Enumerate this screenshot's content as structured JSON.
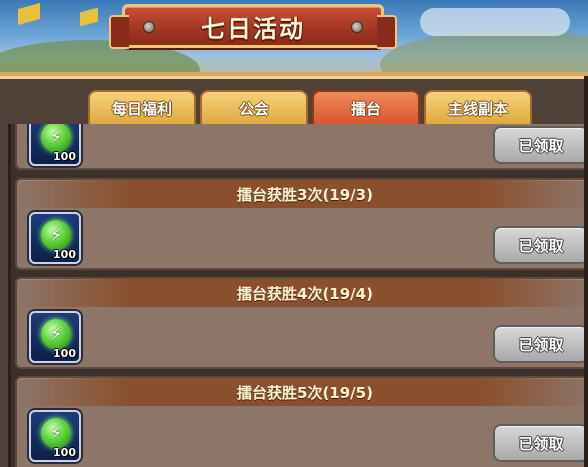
{
  "title": "七日活动",
  "tabs": [
    {
      "label": "每日福利",
      "active": false
    },
    {
      "label": "公会",
      "active": false
    },
    {
      "label": "擂台",
      "active": true
    },
    {
      "label": "主线副本",
      "active": false
    }
  ],
  "partial_card": {
    "reward": {
      "icon": "energy-bolt-icon",
      "quantity": "100"
    },
    "button_label": "已领取"
  },
  "cards": [
    {
      "header": "擂台获胜3次(19/3)",
      "reward": {
        "icon": "energy-bolt-icon",
        "quantity": "100"
      },
      "button_label": "已领取"
    },
    {
      "header": "擂台获胜4次(19/4)",
      "reward": {
        "icon": "energy-bolt-icon",
        "quantity": "100"
      },
      "button_label": "已领取"
    },
    {
      "header": "擂台获胜5次(19/5)",
      "reward": {
        "icon": "energy-bolt-icon",
        "quantity": "100"
      },
      "button_label": "已领取"
    }
  ],
  "colors": {
    "active_tab": "#d8562e",
    "inactive_tab": "#e0a840",
    "card_bg": "#8d7568",
    "claimed_button": "#a9a9a9"
  }
}
